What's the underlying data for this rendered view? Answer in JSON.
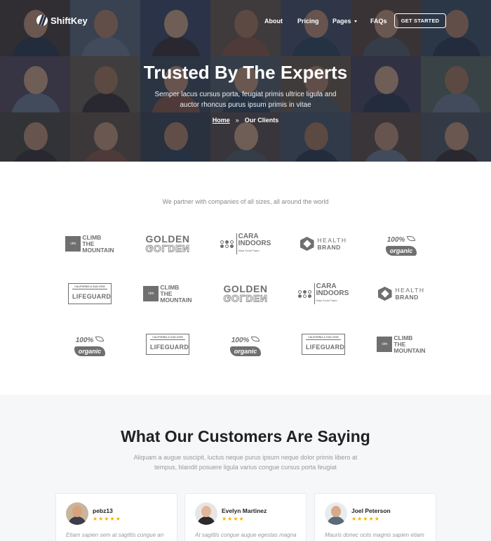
{
  "nav": {
    "brand": "ShiftKey",
    "links": [
      "About",
      "Pricing",
      "Pages",
      "FAQs"
    ],
    "cta": "GET STARTED"
  },
  "hero": {
    "title": "Trusted By The Experts",
    "subtitle": "Semper lacus cursus porta, feugiat primis ultrice ligula and auctor rhoncus purus ipsum primis in vitae",
    "breadcrumb": {
      "home": "Home",
      "separator": "»",
      "current": "Our Clients"
    }
  },
  "partners": {
    "intro": "We partner with companies of all sizes, all around the world",
    "logo_rows": [
      [
        "climb-the-mountain",
        "golden",
        "cara-indoors",
        "health-brand",
        "100-organic"
      ],
      [
        "lifeguard",
        "climb-the-mountain",
        "golden",
        "cara-indoors",
        "health-brand"
      ],
      [
        "100-organic",
        "lifeguard",
        "100-organic",
        "lifeguard",
        "climb-the-mountain"
      ]
    ],
    "logo_text": {
      "climb_box": "ctm",
      "climb_lines": [
        "CLIMB",
        "THE",
        "MOUNTAIN"
      ],
      "golden": "GOLDEN",
      "cara_lines": [
        "CARA",
        "INDOORS"
      ],
      "cara_tag": "Maya Sculpt Pages",
      "health_lines": [
        "HEALTH",
        "BRAND"
      ],
      "organic_pct": "100%",
      "organic_word": "organic",
      "lifeguard_small": "CALIFORNIA & SAN JOSE",
      "lifeguard_big": "LIFEGUARD"
    }
  },
  "testimonials": {
    "title": "What Our Customers Are Saying",
    "subtitle": "Aliquam a augue suscipit, luctus neque purus ipsum neque dolor primis libero at tempus, blandit posuere ligula varius congue cursus porta feugiat",
    "cards": [
      {
        "name": "pebz13",
        "stars": "★★★★★",
        "text": "Etiam sapien sem at sagittis congue an"
      },
      {
        "name": "Evelyn Martinez",
        "stars": "★★★★",
        "text": "At sagittis congue augue egestas magna"
      },
      {
        "name": "Joel Peterson",
        "stars": "★★★★★",
        "text": "Mauris donec ociis magnis sapien etiam"
      }
    ]
  },
  "colors": {
    "hero_overlay": "#1c202c",
    "logo_gray": "#6f6f6f",
    "star": "#f5b400",
    "section_bg": "#f6f7f9"
  }
}
